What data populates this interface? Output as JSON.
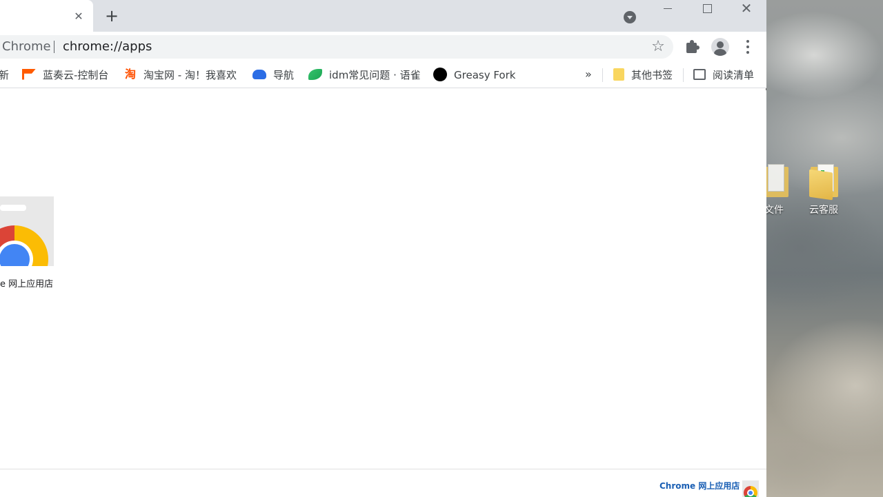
{
  "desktop": {
    "icons": [
      {
        "label": "文件"
      },
      {
        "label": "云客服"
      }
    ]
  },
  "browser": {
    "tab": {
      "close_glyph": "✕"
    },
    "new_tab_glyph": "+",
    "window_close_glyph": "✕",
    "omnibox": {
      "chip": "Chrome",
      "url": "chrome://apps"
    },
    "bookmarks": [
      {
        "label": "新",
        "icon": "truncated"
      },
      {
        "label": "蓝奏云-控制台",
        "icon": "lanzou-flag-icon"
      },
      {
        "label": "淘宝网 - 淘！我喜欢",
        "icon": "taobao-icon",
        "glyph": "淘"
      },
      {
        "label": "导航",
        "icon": "nav-icon"
      },
      {
        "label": "idm常见问题 · 语雀",
        "icon": "yuque-icon"
      },
      {
        "label": "Greasy Fork",
        "icon": "greasyfork-icon"
      }
    ],
    "bookmarks_more": "»",
    "other_bookmarks": "其他书签",
    "reading_list": "阅读清单",
    "apps": [
      {
        "label": "e 网上应用店"
      }
    ],
    "footer": {
      "store_link": "Chrome 网上应用店"
    },
    "colors": {
      "titlebar": "#dee1e6",
      "omnibox": "#f1f3f4",
      "link": "#1a5fb4"
    }
  }
}
